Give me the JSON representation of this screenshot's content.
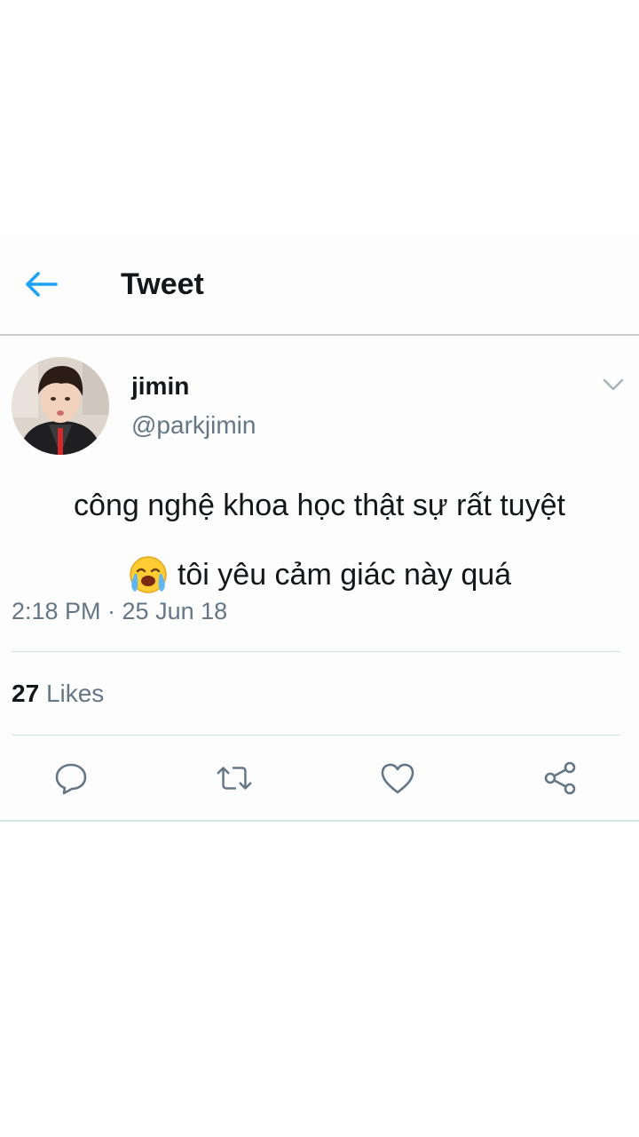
{
  "header": {
    "title": "Tweet",
    "back_icon": "arrow-left-icon"
  },
  "tweet": {
    "display_name": "jimin",
    "handle": "@parkjimin",
    "text_line1": "công nghệ khoa học thật sự rất tuyệt",
    "text_line2": "tôi yêu cảm giác này quá",
    "emoji": "loudly-crying-face",
    "timestamp": "2:18 PM · 25 Jun 18"
  },
  "stats": {
    "likes_count": "27",
    "likes_label": "Likes"
  },
  "actions": [
    "reply-icon",
    "retweet-icon",
    "like-icon",
    "share-icon"
  ],
  "colors": {
    "accent": "#1da1f2",
    "icon_gray": "#657786",
    "text": "#14171a",
    "divider": "#cfe2dc"
  }
}
